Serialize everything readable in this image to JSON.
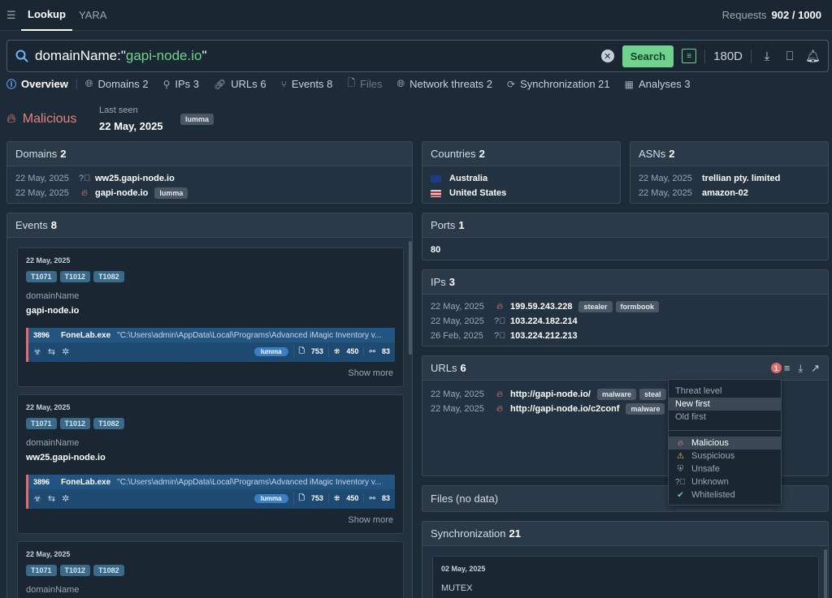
{
  "top": {
    "tabs": [
      "Lookup",
      "YARA"
    ],
    "requests_label": "Requests",
    "requests_value": "902 / 1000"
  },
  "search": {
    "prefix": "domainName:\"",
    "value": "gapi-node.io",
    "suffix": "\"",
    "button": "Search",
    "period": "180D"
  },
  "nav": [
    {
      "label": "Overview"
    },
    {
      "label": "Domains 2"
    },
    {
      "label": "IPs 3"
    },
    {
      "label": "URLs 6"
    },
    {
      "label": "Events 8"
    },
    {
      "label": "Files"
    },
    {
      "label": "Network threats 2"
    },
    {
      "label": "Synchronization 21"
    },
    {
      "label": "Analyses 3"
    }
  ],
  "verdict": {
    "label": "Malicious",
    "last_seen_label": "Last seen",
    "last_seen": "22 May, 2025",
    "tag": "lumma"
  },
  "domains": {
    "title": "Domains",
    "count": "2",
    "rows": [
      {
        "date": "22 May, 2025",
        "value": "ww25.gapi-node.io",
        "tag": ""
      },
      {
        "date": "22 May, 2025",
        "value": "gapi-node.io",
        "tag": "lumma"
      }
    ]
  },
  "countries": {
    "title": "Countries",
    "count": "2",
    "rows": [
      "Australia",
      "United States"
    ]
  },
  "asns": {
    "title": "ASNs",
    "count": "2",
    "rows": [
      {
        "date": "22 May, 2025",
        "value": "trellian pty. limited"
      },
      {
        "date": "22 May, 2025",
        "value": "amazon-02"
      }
    ]
  },
  "events": {
    "title": "Events",
    "count": "8",
    "cards": [
      {
        "date": "22 May, 2025",
        "tags": [
          "T1071",
          "T1012",
          "T1082"
        ],
        "key": "domainName",
        "value": "gapi-node.io",
        "pid": "3896",
        "pname": "FoneLab.exe",
        "cmd": "\"C:\\Users\\admin\\AppData\\Local\\Programs\\Advanced iMagic Inventory v...",
        "family": "lumma",
        "s1": "753",
        "s2": "450",
        "s3": "83",
        "more": "Show more"
      },
      {
        "date": "22 May, 2025",
        "tags": [
          "T1071",
          "T1012",
          "T1082"
        ],
        "key": "domainName",
        "value": "ww25.gapi-node.io",
        "pid": "3896",
        "pname": "FoneLab.exe",
        "cmd": "\"C:\\Users\\admin\\AppData\\Local\\Programs\\Advanced iMagic Inventory v...",
        "family": "lumma",
        "s1": "753",
        "s2": "450",
        "s3": "83",
        "more": "Show more"
      },
      {
        "date": "22 May, 2025",
        "tags": [
          "T1071",
          "T1012",
          "T1082"
        ],
        "key": "domainName"
      }
    ]
  },
  "ports": {
    "title": "Ports",
    "count": "1",
    "value": "80"
  },
  "ips": {
    "title": "IPs",
    "count": "3",
    "rows": [
      {
        "date": "22 May, 2025",
        "value": "199.59.243.228",
        "tags": [
          "stealer",
          "formbook"
        ]
      },
      {
        "date": "22 May, 2025",
        "value": "103.224.182.214",
        "tags": []
      },
      {
        "date": "26 Feb, 2025",
        "value": "103.224.212.213",
        "tags": []
      }
    ]
  },
  "urls": {
    "title": "URLs",
    "count": "6",
    "filter_badge": "1",
    "rows": [
      {
        "date": "22 May, 2025",
        "value": "http://gapi-node.io/",
        "tags": [
          "malware",
          "steal"
        ]
      },
      {
        "date": "22 May, 2025",
        "value": "http://gapi-node.io/c2conf",
        "tags": [
          "malware"
        ]
      }
    ]
  },
  "files": {
    "title": "Files (no data)"
  },
  "sync": {
    "title": "Synchronization",
    "count": "21",
    "date": "02 May, 2025",
    "value": "MUTEX"
  },
  "dropdown": {
    "sort": [
      "Threat level",
      "New first",
      "Old first"
    ],
    "levels": [
      "Malicious",
      "Suspicious",
      "Unsafe",
      "Unknown",
      "Whitelisted"
    ]
  }
}
